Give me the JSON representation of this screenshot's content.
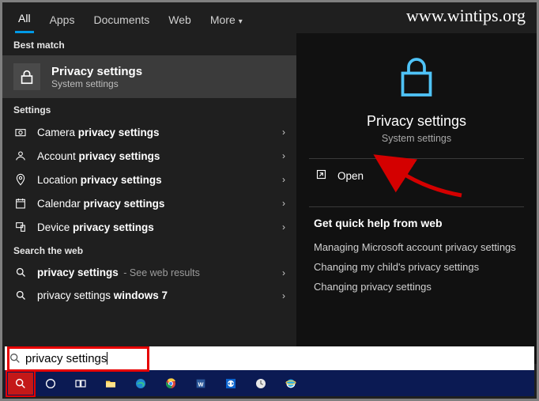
{
  "watermark": "www.wintips.org",
  "tabs": {
    "all": "All",
    "apps": "Apps",
    "documents": "Documents",
    "web": "Web",
    "more": "More"
  },
  "sections": {
    "best_match": "Best match",
    "settings": "Settings",
    "search_web": "Search the web"
  },
  "best_match": {
    "title": "Privacy settings",
    "sub": "System settings"
  },
  "settings_items": [
    {
      "prefix": "Camera ",
      "bold": "privacy settings"
    },
    {
      "prefix": "Account ",
      "bold": "privacy settings"
    },
    {
      "prefix": "Location ",
      "bold": "privacy settings"
    },
    {
      "prefix": "Calendar ",
      "bold": "privacy settings"
    },
    {
      "prefix": "Device ",
      "bold": "privacy settings"
    }
  ],
  "web_items": [
    {
      "bold": "privacy settings",
      "suffix": " - See web results"
    },
    {
      "prefix": "privacy settings ",
      "bold2": "windows 7"
    }
  ],
  "preview": {
    "title": "Privacy settings",
    "sub": "System settings",
    "open": "Open",
    "quick_help": "Get quick help from web",
    "links": [
      "Managing Microsoft account privacy settings",
      "Changing my child's privacy settings",
      "Changing privacy settings"
    ]
  },
  "search": {
    "value": "privacy settings"
  }
}
